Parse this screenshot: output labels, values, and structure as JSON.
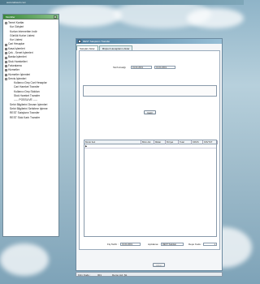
{
  "window": {
    "title": "www.tabiweb.com"
  },
  "tree": {
    "title": "Modüller",
    "items": [
      {
        "label": "Temel Kartlar",
        "level": 1,
        "expander": "-"
      },
      {
        "label": "Kur Girişleri",
        "level": 2
      },
      {
        "label": "Kurları Internetten Indir",
        "level": 2
      },
      {
        "label": "Günlük Kurlar Listesi",
        "level": 2
      },
      {
        "label": "Kur Listesi",
        "level": 2
      },
      {
        "label": "Cari Hesaplar",
        "level": 1,
        "expander": "+"
      },
      {
        "label": "Kasa İşlemleri",
        "level": 1,
        "expander": "+"
      },
      {
        "label": "Çek - Senet İşlemleri",
        "level": 1,
        "expander": "+"
      },
      {
        "label": "Banka İşlemleri",
        "level": 1,
        "expander": "+"
      },
      {
        "label": "Stok Hareketleri",
        "level": 1,
        "expander": "+"
      },
      {
        "label": "Faturalama",
        "level": 1,
        "expander": "+"
      },
      {
        "label": "Hizmetler",
        "level": 1,
        "expander": "+"
      },
      {
        "label": "Hizmetler İşlemleri",
        "level": 1,
        "expander": "+"
      },
      {
        "label": "Servis İşlemleri",
        "level": 1,
        "expander": "-"
      },
      {
        "label": "Kullanıcı Dep Cari Hesaplar",
        "level": 3
      },
      {
        "label": "Cari Hareket Transfer",
        "level": 3
      },
      {
        "label": "Kullanıcı Dep Stokları",
        "level": 3
      },
      {
        "label": "Stok Hareket Transfer",
        "level": 3
      },
      {
        "label": "----- POSSLIVE -----",
        "level": 3
      },
      {
        "label": "Sehir Bilgilerini Devam İşlemleri",
        "level": 2
      },
      {
        "label": "Sehir Bilgilerini Sehirlere İşleme",
        "level": 2
      },
      {
        "label": "REST Satışların Transfer",
        "level": 2
      },
      {
        "label": "REST Stok Kartı Transfer",
        "level": 2
      }
    ]
  },
  "main": {
    "title": "REST Satışların Transfer",
    "tabs": [
      "Satışları Aktar",
      "Müşteri Hesaplarını Aktar"
    ],
    "date_label": "Tarih Aralığı",
    "date_from": "01.04.2019",
    "date_to": "01.04.2019",
    "load_button": "Getir",
    "table_columns": [
      "Bordo Seri",
      "Birim Adı",
      "Miktar",
      "B.Fiyat",
      "Tutar",
      "KDV%",
      "KDVTUT"
    ],
    "fis_label": "Fiş Tarihi :",
    "fis_value": "01.04.2019",
    "aciklama_label": "Açıklama :",
    "aciklama_value": "REST Satışları",
    "depo_label": "Depo Kodu :",
    "transfer_button": "Aktar"
  },
  "status": {
    "firm_label": "Firm Kodu :",
    "firm_code": "001",
    "firm_name": "Demo Ltd. Şti."
  }
}
